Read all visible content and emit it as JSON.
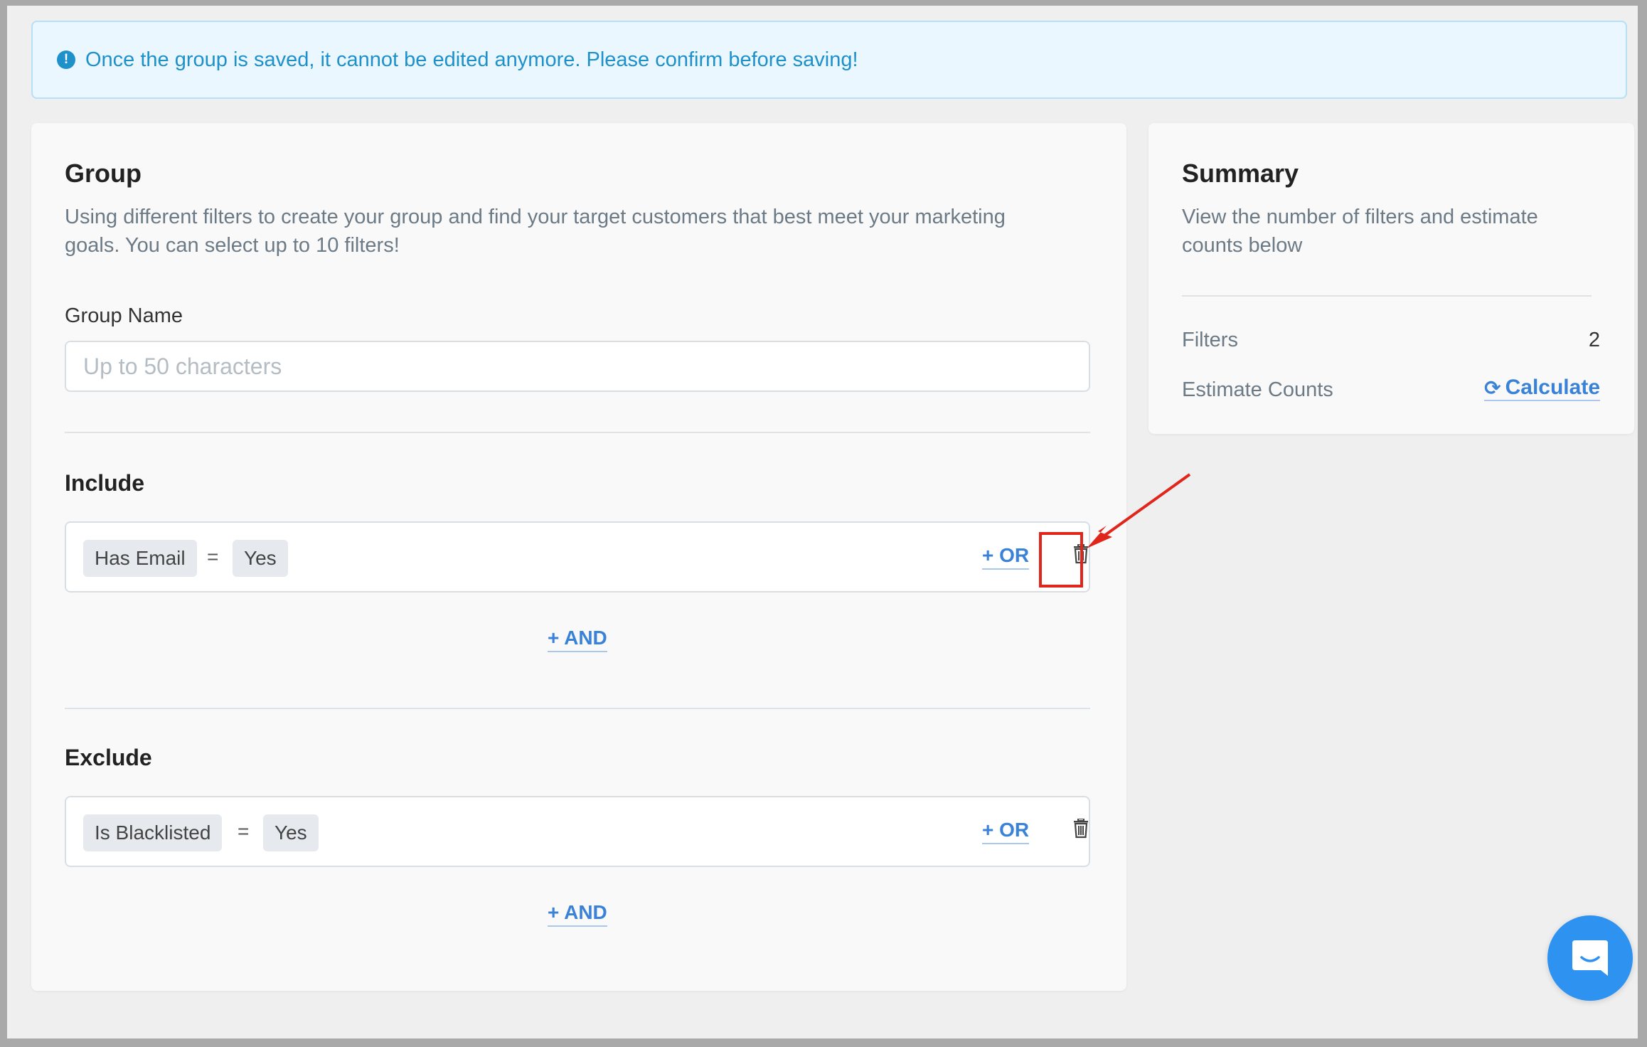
{
  "alert": {
    "icon": "exclamation-circle-icon",
    "message": "Once the group is saved, it cannot be edited anymore. Please confirm before saving!"
  },
  "group": {
    "title": "Group",
    "description_line1": "Using different filters to create your group and find your target customers that best meet your marketing",
    "description_line2": "goals. You can select up to 10 filters!",
    "name_label": "Group Name",
    "name_placeholder": "Up to 50 characters",
    "name_value": ""
  },
  "include": {
    "title": "Include",
    "filter": {
      "field": "Has Email",
      "operator": "=",
      "value": "Yes"
    },
    "or_label": "+ OR",
    "and_label": "+ AND"
  },
  "exclude": {
    "title": "Exclude",
    "filter": {
      "field": "Is Blacklisted",
      "operator": "=",
      "value": "Yes"
    },
    "or_label": "+ OR",
    "and_label": "+ AND"
  },
  "summary": {
    "title": "Summary",
    "description_line1": "View the number of filters and estimate",
    "description_line2": "counts below",
    "filters_label": "Filters",
    "filters_value": "2",
    "estimate_label": "Estimate Counts",
    "calculate_label": "Calculate"
  },
  "colors": {
    "accent": "#3a82d8",
    "alert_text": "#1e90ca",
    "annotation": "#e0261b",
    "chat": "#2e92f1"
  }
}
